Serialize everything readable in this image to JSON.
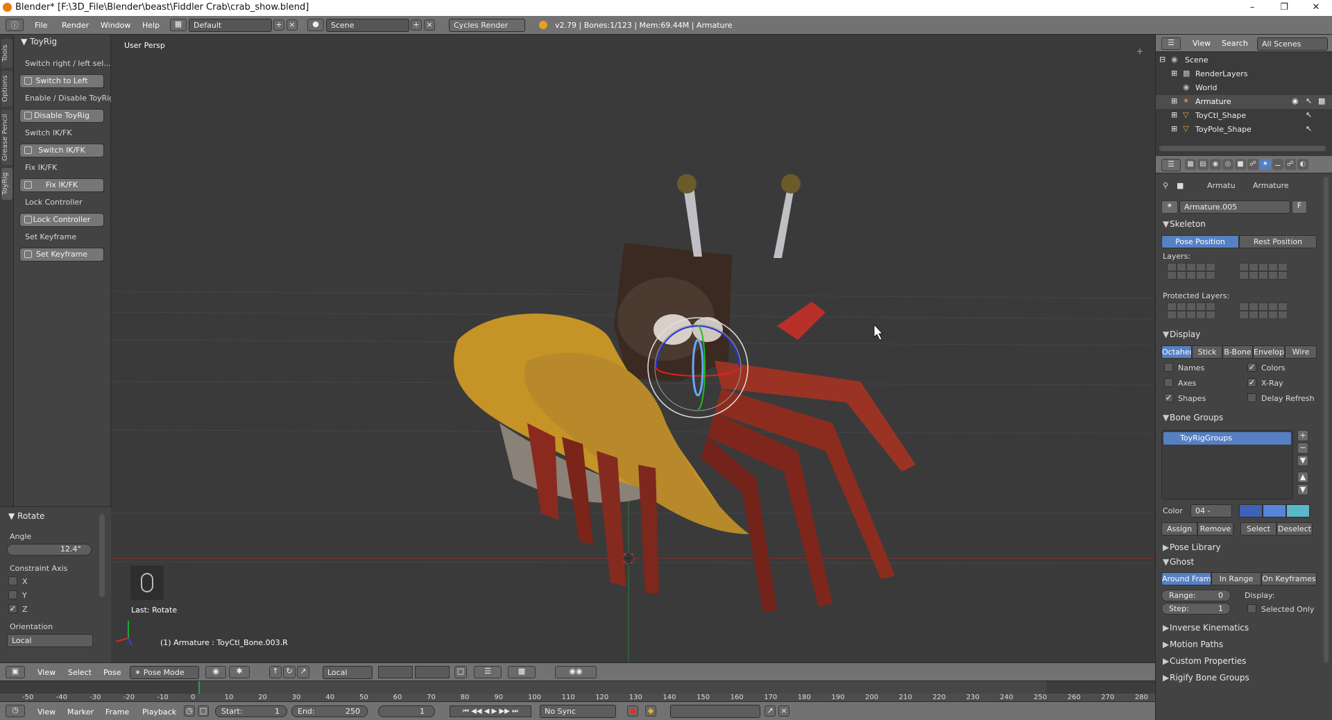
{
  "window": {
    "title": "Blender* [F:\\3D_File\\Blender\\beast\\Fiddler Crab\\crab_show.blend]"
  },
  "infobar": {
    "menus": [
      "File",
      "Render",
      "Window",
      "Help"
    ],
    "layout": "Default",
    "scene": "Scene",
    "engine": "Cycles Render",
    "stats": "v2.79 | Bones:1/123 | Mem:69.44M | Armature"
  },
  "tabs": [
    "Tools",
    "Options",
    "Grease Pencil",
    "ToyRig"
  ],
  "toolbox": {
    "panel_title": "ToyRig",
    "groups": [
      {
        "label": "Switch right / left sel...",
        "button": "Switch to Left"
      },
      {
        "label": "Enable / Disable ToyRig",
        "button": "Disable ToyRig"
      },
      {
        "label": "Switch IK/FK",
        "button": "Switch IK/FK"
      },
      {
        "label": "Fix IK/FK",
        "button": "Fix IK/FK"
      },
      {
        "label": "Lock Controller",
        "button": "Lock Controller"
      },
      {
        "label": "Set Keyframe",
        "button": "Set Keyframe"
      }
    ]
  },
  "redo": {
    "title": "Rotate",
    "angle_label": "Angle",
    "angle_value": "12.4°",
    "constraint_label": "Constraint Axis",
    "axes": [
      {
        "name": "X",
        "checked": false
      },
      {
        "name": "Y",
        "checked": false
      },
      {
        "name": "Z",
        "checked": true
      }
    ],
    "orientation_label": "Orientation",
    "orientation_value": "Local"
  },
  "viewport": {
    "view_name": "User Persp",
    "last_op": "Last: Rotate",
    "status": "(1) Armature : ToyCtl_Bone.003.R"
  },
  "view3d_header": {
    "menus": [
      "View",
      "Select",
      "Pose"
    ],
    "mode": "Pose Mode",
    "orientation": "Local"
  },
  "timeline": {
    "ticks": [
      "-50",
      "-40",
      "-30",
      "-20",
      "-10",
      "0",
      "10",
      "20",
      "30",
      "40",
      "50",
      "60",
      "70",
      "80",
      "90",
      "100",
      "110",
      "120",
      "130",
      "140",
      "150",
      "160",
      "170",
      "180",
      "190",
      "200",
      "210",
      "220",
      "230",
      "240",
      "250",
      "260",
      "270",
      "280"
    ],
    "menus": [
      "View",
      "Marker",
      "Frame",
      "Playback"
    ],
    "start_label": "Start:",
    "start_value": "1",
    "end_label": "End:",
    "end_value": "250",
    "current_frame": "1",
    "sync": "No Sync"
  },
  "outliner": {
    "menus": [
      "View",
      "Search"
    ],
    "filter": "All Scenes",
    "rows": [
      "Scene",
      "RenderLayers",
      "World",
      "Armature",
      "ToyCtl_Shape",
      "ToyPole_Shape"
    ]
  },
  "properties": {
    "breadcrumb": [
      "Armatu",
      "Armature"
    ],
    "datablock": "Armature.005",
    "fake_user": "F",
    "skeleton": {
      "title": "Skeleton",
      "pose_position": "Pose Position",
      "rest_position": "Rest Position",
      "layers_label": "Layers:",
      "protected_label": "Protected Layers:"
    },
    "display": {
      "title": "Display",
      "types": [
        "Octahed",
        "Stick",
        "B-Bone",
        "Envelop",
        "Wire"
      ],
      "options": [
        {
          "label": "Names",
          "checked": false
        },
        {
          "label": "Colors",
          "checked": true
        },
        {
          "label": "Axes",
          "checked": false
        },
        {
          "label": "X-Ray",
          "checked": true
        },
        {
          "label": "Shapes",
          "checked": true
        },
        {
          "label": "Delay Refresh",
          "checked": false
        }
      ]
    },
    "bone_groups": {
      "title": "Bone Groups",
      "item": "ToyRigGroups",
      "color_label": "Color",
      "color_value": "04 -",
      "buttons": [
        "Assign",
        "Remove",
        "Select",
        "Deselect"
      ]
    },
    "pose_library": "Pose Library",
    "ghost": {
      "title": "Ghost",
      "modes": [
        "Around Frame",
        "In Range",
        "On Keyframes"
      ],
      "range_label": "Range:",
      "range_value": "0",
      "step_label": "Step:",
      "step_value": "1",
      "display_label": "Display:",
      "selected_only": "Selected Only"
    },
    "collapsed": [
      "Inverse Kinematics",
      "Motion Paths",
      "Custom Properties",
      "Rigify Bone Groups"
    ]
  },
  "colors": {
    "accent": "#5680c2",
    "header": "#727272",
    "panel": "#434343",
    "viewport": "#3a3a3a"
  }
}
